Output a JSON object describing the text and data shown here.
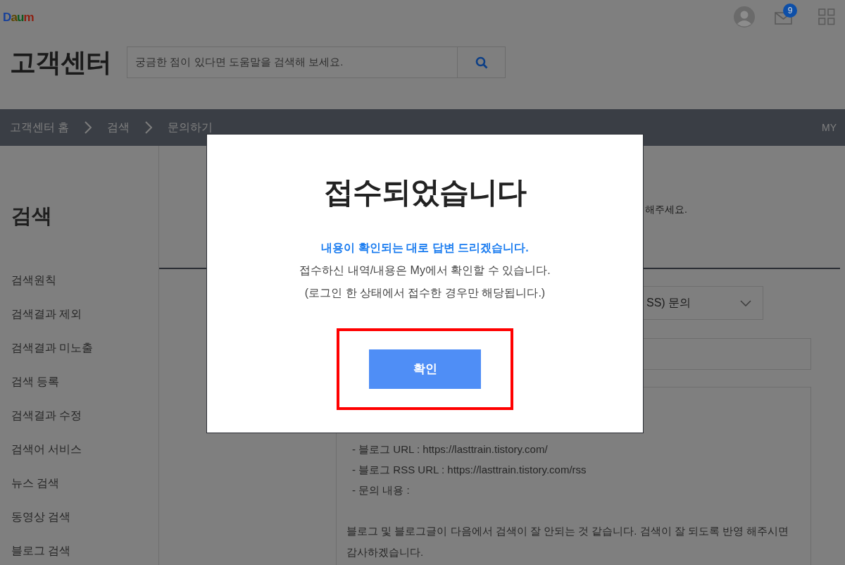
{
  "header": {
    "logo": "Daum",
    "mail_badge": "9"
  },
  "title": "고객센터",
  "search": {
    "placeholder": "궁금한 점이 있다면 도움말을 검색해 보세요."
  },
  "breadcrumb": [
    "고객센터 홈",
    "검색",
    "문의하기"
  ],
  "my_link": "MY",
  "sidebar": {
    "heading": "검색",
    "items": [
      "검색원칙",
      "검색결과 제외",
      "검색결과 미노출",
      "검색 등록",
      "검색결과 수정",
      "검색어 서비스",
      "뉴스 검색",
      "동영상 검색",
      "블로그 검색"
    ]
  },
  "form": {
    "notice": "해주세요.",
    "category": "SS) 문의",
    "body_lines": [
      "- 블로그 URL : https://lasttrain.tistory.com/",
      "- 블로그 RSS URL : https://lasttrain.tistory.com/rss",
      "- 문의 내용 :"
    ],
    "body_paragraph": "블로그 및 블로그글이 다음에서 검색이 잘 안되는 것 같습니다. 검색이 잘 되도록 반영 해주시면 감사하겠습니다."
  },
  "dialog": {
    "title": "접수되었습니다",
    "highlight": "내용이 확인되는 대로 답변 드리겠습니다.",
    "lines": [
      "접수하신 내역/내용은 My에서 확인할 수 있습니다.",
      "(로그인 한 상태에서 접수한 경우만 해당됩니다.)"
    ],
    "button": {
      "label": "확인",
      "highlighted": true
    }
  }
}
